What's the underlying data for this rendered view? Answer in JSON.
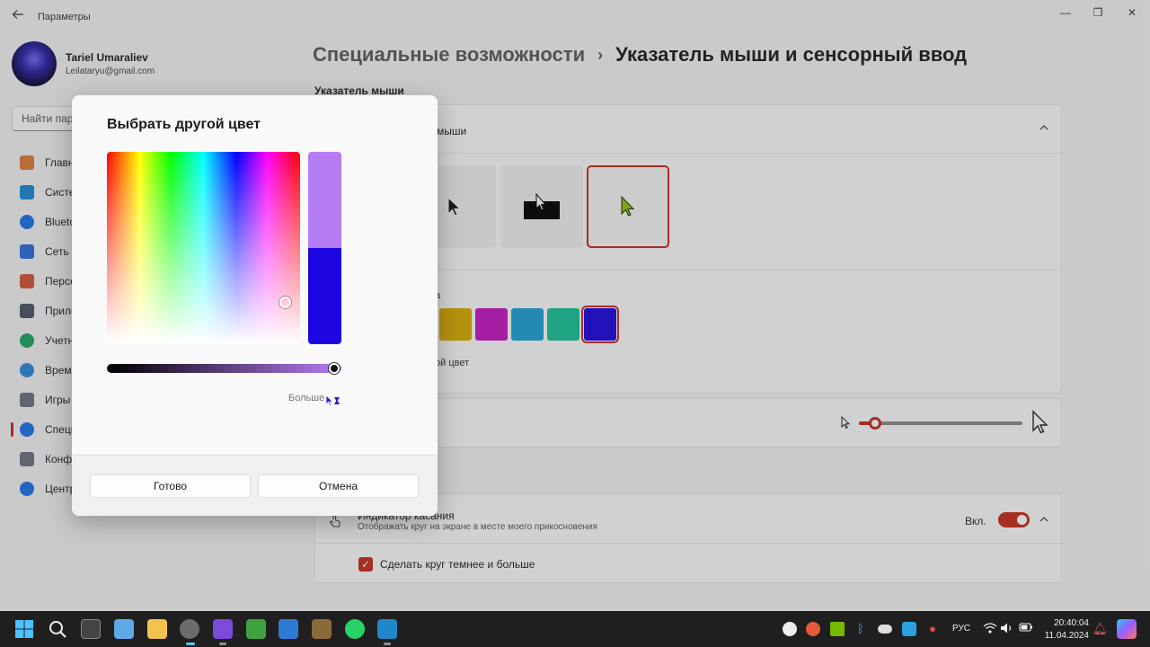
{
  "window": {
    "app_title": "Параметры",
    "minimize": "—",
    "restore": "❐",
    "close": "✕"
  },
  "user": {
    "name": "Tariel Umaraliev",
    "email": "Leilataryu@gmail.com"
  },
  "search": {
    "placeholder": "Найти пара"
  },
  "sidebar": {
    "items": [
      {
        "label": "Главн",
        "icon": "home-icon",
        "color": "#e07a3b"
      },
      {
        "label": "Систе",
        "icon": "system-icon",
        "color": "#1a8ad4"
      },
      {
        "label": "Blueto",
        "icon": "bluetooth-icon",
        "color": "#1a73e8"
      },
      {
        "label": "Сеть и",
        "icon": "network-icon",
        "color": "#2b6cdb"
      },
      {
        "label": "Персо",
        "icon": "brush-icon",
        "color": "#d2553a"
      },
      {
        "label": "Прило",
        "icon": "apps-icon",
        "color": "#4b5563"
      },
      {
        "label": "Учетн",
        "icon": "account-icon",
        "color": "#1fa463"
      },
      {
        "label": "Время",
        "icon": "globe-icon",
        "color": "#2b88d8"
      },
      {
        "label": "Игры",
        "icon": "gamepad-icon",
        "color": "#6b7280"
      },
      {
        "label": "Специ",
        "icon": "accessibility-icon",
        "color": "#1a73e8"
      },
      {
        "label": "Конф",
        "icon": "shield-icon",
        "color": "#6b7280"
      },
      {
        "label": "Центр",
        "icon": "update-icon",
        "color": "#1a73e8"
      }
    ]
  },
  "breadcrumb": {
    "parent": "Специальные возможности",
    "separator": "›",
    "current": "Указатель мыши и сенсорный ввод"
  },
  "main": {
    "section_title": "Указатель мыши",
    "style_label": "мыши",
    "colors_caption": "а",
    "custom_color_label": "ой цвет",
    "swatches": [
      "#d8ab00",
      "#c316c1",
      "#1da1d6",
      "#17c098",
      "#1d06e0"
    ],
    "size_level": 0.1,
    "touch_title": "Индикатор касания",
    "touch_desc": "Отображать круг на экране в месте моего прикосновения",
    "toggle_label": "Вкл.",
    "checkbox_label": "Сделать круг темнее и больше",
    "accent": "#c42b1c"
  },
  "dialog": {
    "title": "Выбрать другой цвет",
    "more_label": "Больше",
    "new_color": "#b57cf5",
    "old_color": "#1d06e0",
    "done_label": "Готово",
    "cancel_label": "Отмена"
  },
  "taskbar": {
    "lang": "РУС",
    "time": "20:40:04",
    "date": "11.04.2024"
  }
}
